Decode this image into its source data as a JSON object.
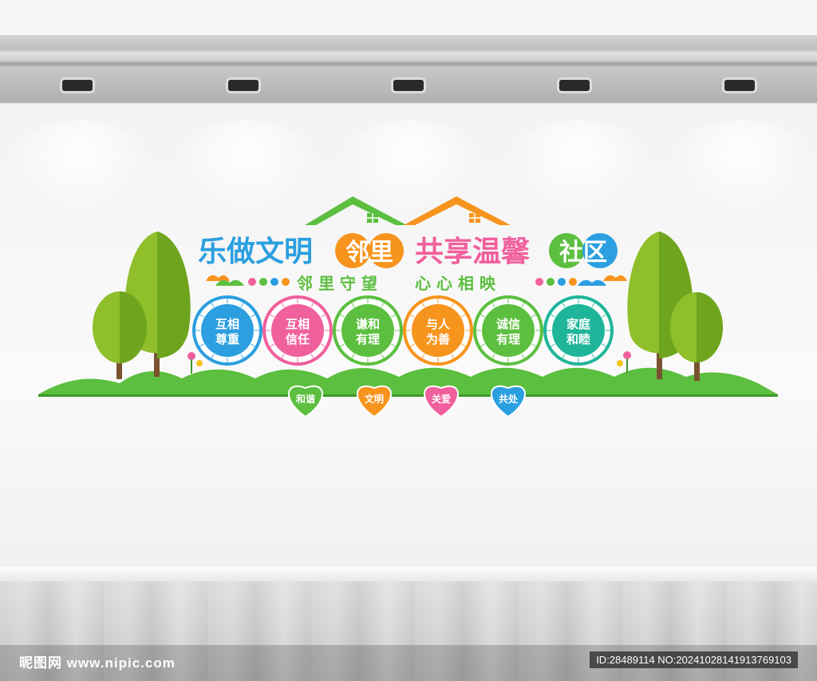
{
  "title": {
    "part1": "乐做文明",
    "badge_left": "邻里",
    "part2": "共享温馨",
    "badge_right": "社区"
  },
  "subtitle": {
    "left": "邻 里 守 望",
    "right": "心 心 相 映"
  },
  "circles": [
    {
      "line1": "互相",
      "line2": "尊重",
      "color": "#2b9fe0"
    },
    {
      "line1": "互相",
      "line2": "信任",
      "color": "#f0609c"
    },
    {
      "line1": "谦和",
      "line2": "有理",
      "color": "#5cbf3f"
    },
    {
      "line1": "与人",
      "line2": "为善",
      "color": "#f7941d"
    },
    {
      "line1": "诚信",
      "line2": "有理",
      "color": "#5cbf3f"
    },
    {
      "line1": "家庭",
      "line2": "和睦",
      "color": "#1fb59a"
    }
  ],
  "hearts": [
    {
      "label": "和谐",
      "color": "#5cbf3f"
    },
    {
      "label": "文明",
      "color": "#f7941d"
    },
    {
      "label": "关爱",
      "color": "#f0609c"
    },
    {
      "label": "共处",
      "color": "#2b9fe0"
    }
  ],
  "colors": {
    "blue": "#2b9fe0",
    "green": "#5cbf3f",
    "orange": "#f7941d",
    "pink": "#f0609c",
    "tree": "#8fbf2a"
  },
  "watermark": {
    "left": "昵图网 www.nipic.com",
    "right": "ID:28489114 NO:20241028141913769103"
  }
}
